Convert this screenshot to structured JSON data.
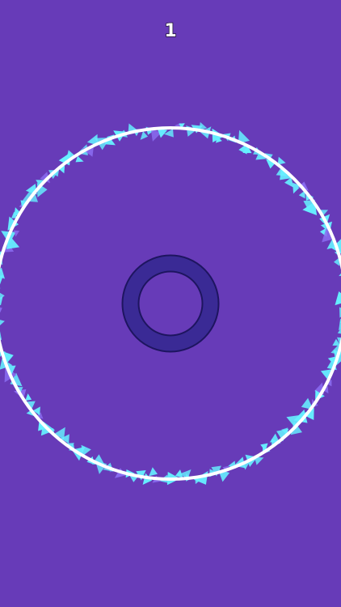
{
  "score": "1",
  "colors": {
    "background": "#673bb8",
    "ring": "#ffffff",
    "shard_primary": "#66f0ff",
    "shard_secondary": "#8a6cf0",
    "center_ring": "#3a2a95",
    "center_ring_edge": "#1e1560"
  },
  "icons": {
    "center": "player-ring-icon",
    "arena": "arena-ring-icon"
  }
}
